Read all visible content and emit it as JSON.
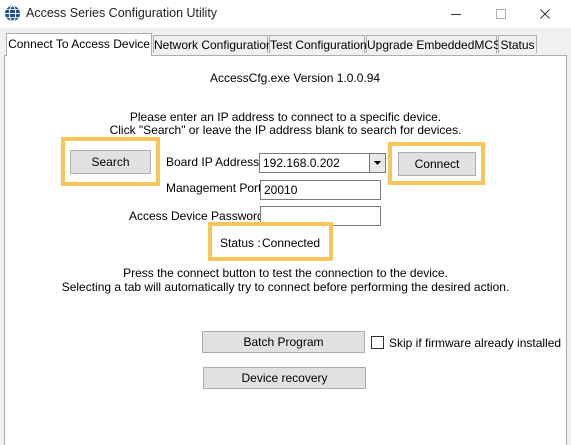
{
  "window": {
    "title": "Access Series Configuration Utility",
    "minimize_icon": "minimize-icon",
    "maximize_icon": "maximize-icon",
    "close_icon": "close-icon"
  },
  "tabs": [
    {
      "label": "Connect To Access Device",
      "active": true
    },
    {
      "label": "Network Configuration",
      "active": false
    },
    {
      "label": "Test Configuration",
      "active": false
    },
    {
      "label": "Upgrade EmbeddedMCS",
      "active": false
    },
    {
      "label": "Status",
      "active": false
    }
  ],
  "connect": {
    "version": "AccessCfg.exe Version 1.0.0.94",
    "instruction_line1": "Please enter an IP address to connect to a specific device.",
    "instruction_line2": "Click \"Search\" or leave the IP address blank to search for devices.",
    "search_button": "Search",
    "board_ip_label": "Board IP Address :",
    "board_ip_value": "192.168.0.202",
    "management_port_label": "Management Port :",
    "management_port_value": "20010",
    "password_label": "Access Device Password :",
    "password_value": "",
    "connect_button": "Connect",
    "status_label": "Status :",
    "status_value": "Connected",
    "info_line1": "Press the connect button to test the connection to the device.",
    "info_line2": "Selecting a tab will automatically try to connect before performing the desired action.",
    "batch_program_button": "Batch Program",
    "skip_firmware_label": "Skip if firmware already installed",
    "skip_firmware_checked": false,
    "device_recovery_button": "Device recovery"
  },
  "colors": {
    "highlight": "#f8c55a",
    "app_icon": "#1e4f8c"
  }
}
